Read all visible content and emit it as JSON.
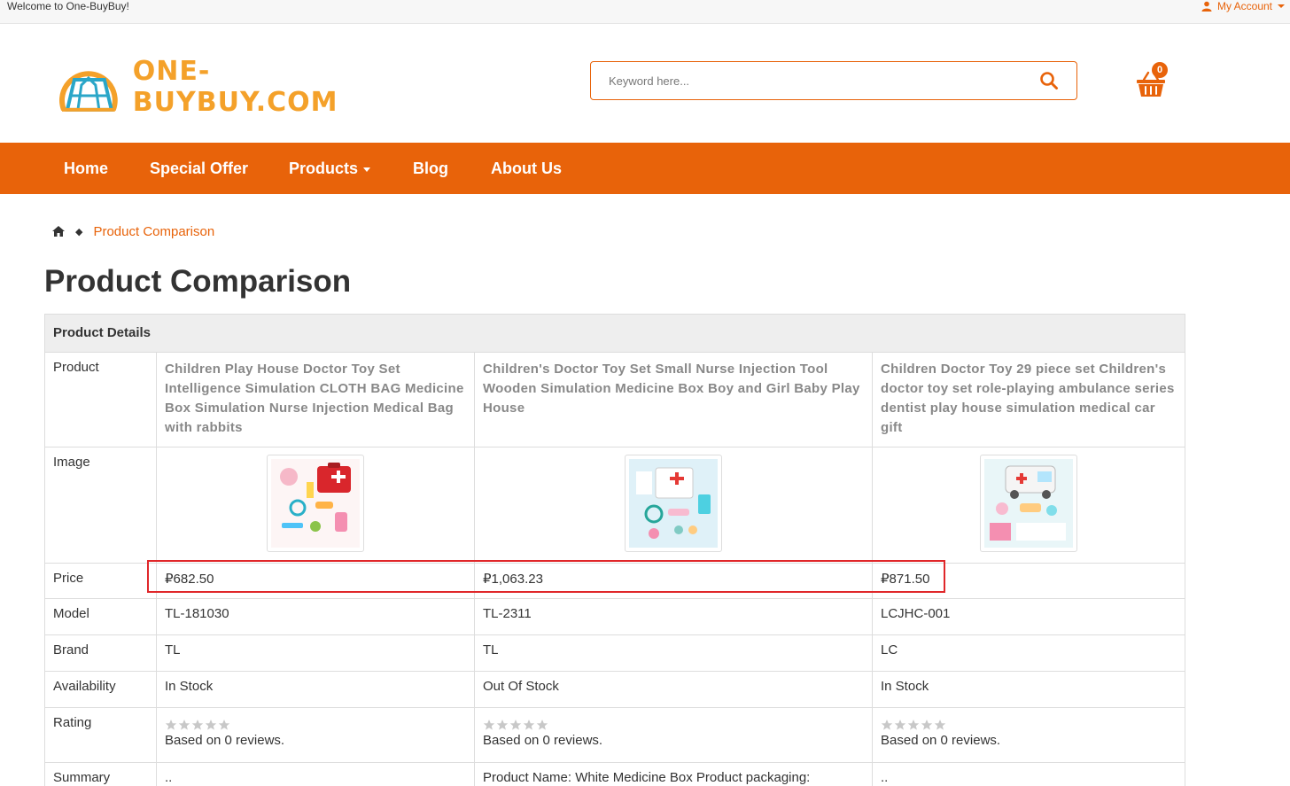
{
  "topbar": {
    "welcome": "Welcome to One-BuyBuy!",
    "account_label": "My Account"
  },
  "logo": {
    "text": "ONE-BUYBUY.COM"
  },
  "search": {
    "placeholder": "Keyword here..."
  },
  "cart": {
    "count": "0"
  },
  "nav": {
    "home": "Home",
    "special_offer": "Special Offer",
    "products": "Products",
    "blog": "Blog",
    "about": "About Us"
  },
  "breadcrumb": {
    "current": "Product Comparison"
  },
  "page": {
    "title": "Product Comparison"
  },
  "table": {
    "header": "Product Details",
    "labels": {
      "product": "Product",
      "image": "Image",
      "price": "Price",
      "model": "Model",
      "brand": "Brand",
      "availability": "Availability",
      "rating": "Rating",
      "summary": "Summary"
    },
    "products": [
      {
        "name": "Children Play House Doctor Toy Set Intelligence Simulation CLOTH BAG Medicine Box Simulation Nurse Injection Medical Bag with rabbits",
        "price": "₽682.50",
        "model": "TL-181030",
        "brand": "TL",
        "availability": "In Stock",
        "reviews": "Based on 0 reviews.",
        "summary": ".."
      },
      {
        "name": "Children's Doctor Toy Set Small Nurse Injection Tool Wooden Simulation Medicine Box Boy and Girl Baby Play House",
        "price": "₽1,063.23",
        "model": "TL-2311",
        "brand": "TL",
        "availability": "Out Of Stock",
        "reviews": "Based on 0 reviews.",
        "summary": "Product Name: White Medicine Box Product packaging:"
      },
      {
        "name": "Children Doctor Toy 29 piece set Children's doctor toy set role-playing ambulance series dentist play house simulation medical car gift",
        "price": "₽871.50",
        "model": "LCJHC-001",
        "brand": "LC",
        "availability": "In Stock",
        "reviews": "Based on 0 reviews.",
        "summary": ".."
      }
    ]
  },
  "colors": {
    "accent": "#e8630a",
    "logo": "#f4a12a",
    "highlight": "#e0272a"
  }
}
